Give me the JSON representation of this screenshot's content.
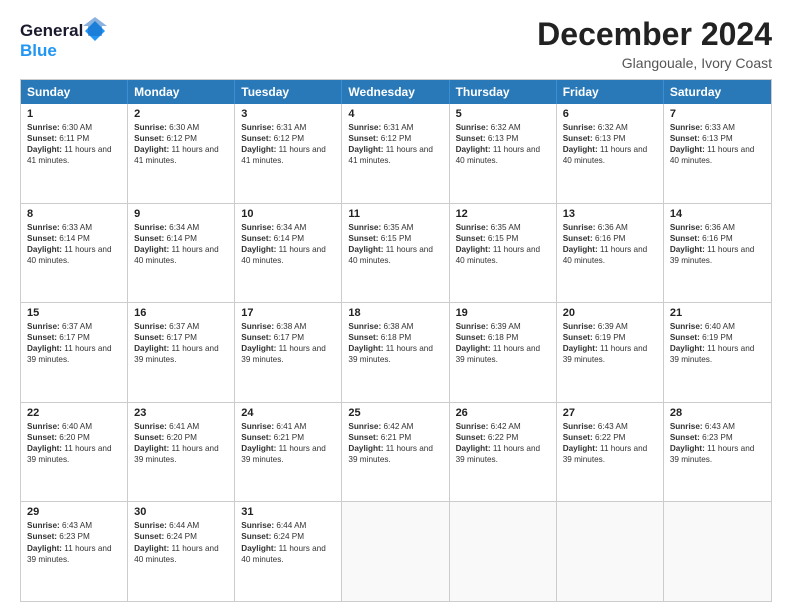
{
  "logo": {
    "line1": "General",
    "line2": "Blue"
  },
  "title": "December 2024",
  "location": "Glangouale, Ivory Coast",
  "days_of_week": [
    "Sunday",
    "Monday",
    "Tuesday",
    "Wednesday",
    "Thursday",
    "Friday",
    "Saturday"
  ],
  "weeks": [
    [
      {
        "day": "1",
        "sunrise": "6:30 AM",
        "sunset": "6:11 PM",
        "daylight": "11 hours and 41 minutes."
      },
      {
        "day": "2",
        "sunrise": "6:30 AM",
        "sunset": "6:12 PM",
        "daylight": "11 hours and 41 minutes."
      },
      {
        "day": "3",
        "sunrise": "6:31 AM",
        "sunset": "6:12 PM",
        "daylight": "11 hours and 41 minutes."
      },
      {
        "day": "4",
        "sunrise": "6:31 AM",
        "sunset": "6:12 PM",
        "daylight": "11 hours and 41 minutes."
      },
      {
        "day": "5",
        "sunrise": "6:32 AM",
        "sunset": "6:13 PM",
        "daylight": "11 hours and 40 minutes."
      },
      {
        "day": "6",
        "sunrise": "6:32 AM",
        "sunset": "6:13 PM",
        "daylight": "11 hours and 40 minutes."
      },
      {
        "day": "7",
        "sunrise": "6:33 AM",
        "sunset": "6:13 PM",
        "daylight": "11 hours and 40 minutes."
      }
    ],
    [
      {
        "day": "8",
        "sunrise": "6:33 AM",
        "sunset": "6:14 PM",
        "daylight": "11 hours and 40 minutes."
      },
      {
        "day": "9",
        "sunrise": "6:34 AM",
        "sunset": "6:14 PM",
        "daylight": "11 hours and 40 minutes."
      },
      {
        "day": "10",
        "sunrise": "6:34 AM",
        "sunset": "6:14 PM",
        "daylight": "11 hours and 40 minutes."
      },
      {
        "day": "11",
        "sunrise": "6:35 AM",
        "sunset": "6:15 PM",
        "daylight": "11 hours and 40 minutes."
      },
      {
        "day": "12",
        "sunrise": "6:35 AM",
        "sunset": "6:15 PM",
        "daylight": "11 hours and 40 minutes."
      },
      {
        "day": "13",
        "sunrise": "6:36 AM",
        "sunset": "6:16 PM",
        "daylight": "11 hours and 40 minutes."
      },
      {
        "day": "14",
        "sunrise": "6:36 AM",
        "sunset": "6:16 PM",
        "daylight": "11 hours and 39 minutes."
      }
    ],
    [
      {
        "day": "15",
        "sunrise": "6:37 AM",
        "sunset": "6:17 PM",
        "daylight": "11 hours and 39 minutes."
      },
      {
        "day": "16",
        "sunrise": "6:37 AM",
        "sunset": "6:17 PM",
        "daylight": "11 hours and 39 minutes."
      },
      {
        "day": "17",
        "sunrise": "6:38 AM",
        "sunset": "6:17 PM",
        "daylight": "11 hours and 39 minutes."
      },
      {
        "day": "18",
        "sunrise": "6:38 AM",
        "sunset": "6:18 PM",
        "daylight": "11 hours and 39 minutes."
      },
      {
        "day": "19",
        "sunrise": "6:39 AM",
        "sunset": "6:18 PM",
        "daylight": "11 hours and 39 minutes."
      },
      {
        "day": "20",
        "sunrise": "6:39 AM",
        "sunset": "6:19 PM",
        "daylight": "11 hours and 39 minutes."
      },
      {
        "day": "21",
        "sunrise": "6:40 AM",
        "sunset": "6:19 PM",
        "daylight": "11 hours and 39 minutes."
      }
    ],
    [
      {
        "day": "22",
        "sunrise": "6:40 AM",
        "sunset": "6:20 PM",
        "daylight": "11 hours and 39 minutes."
      },
      {
        "day": "23",
        "sunrise": "6:41 AM",
        "sunset": "6:20 PM",
        "daylight": "11 hours and 39 minutes."
      },
      {
        "day": "24",
        "sunrise": "6:41 AM",
        "sunset": "6:21 PM",
        "daylight": "11 hours and 39 minutes."
      },
      {
        "day": "25",
        "sunrise": "6:42 AM",
        "sunset": "6:21 PM",
        "daylight": "11 hours and 39 minutes."
      },
      {
        "day": "26",
        "sunrise": "6:42 AM",
        "sunset": "6:22 PM",
        "daylight": "11 hours and 39 minutes."
      },
      {
        "day": "27",
        "sunrise": "6:43 AM",
        "sunset": "6:22 PM",
        "daylight": "11 hours and 39 minutes."
      },
      {
        "day": "28",
        "sunrise": "6:43 AM",
        "sunset": "6:23 PM",
        "daylight": "11 hours and 39 minutes."
      }
    ],
    [
      {
        "day": "29",
        "sunrise": "6:43 AM",
        "sunset": "6:23 PM",
        "daylight": "11 hours and 39 minutes."
      },
      {
        "day": "30",
        "sunrise": "6:44 AM",
        "sunset": "6:24 PM",
        "daylight": "11 hours and 40 minutes."
      },
      {
        "day": "31",
        "sunrise": "6:44 AM",
        "sunset": "6:24 PM",
        "daylight": "11 hours and 40 minutes."
      },
      null,
      null,
      null,
      null
    ]
  ],
  "labels": {
    "sunrise": "Sunrise:",
    "sunset": "Sunset:",
    "daylight": "Daylight:"
  }
}
